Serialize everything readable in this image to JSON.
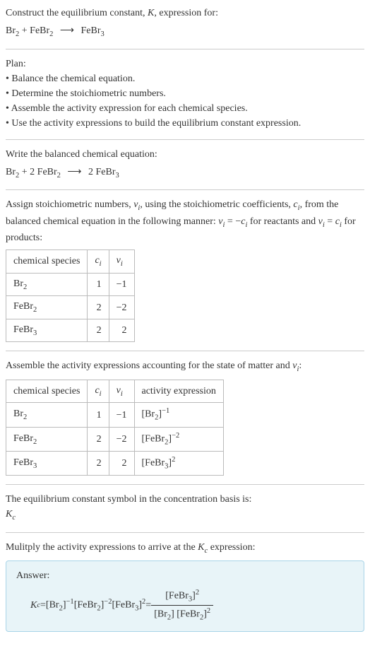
{
  "intro": {
    "line1": "Construct the equilibrium constant, ",
    "K": "K",
    "line1b": ", expression for:",
    "eq_lhs1": "Br",
    "eq_lhs1_sub": "2",
    "plus": " + ",
    "eq_lhs2": "FeBr",
    "eq_lhs2_sub": "2",
    "arrow": "⟶",
    "eq_rhs": "FeBr",
    "eq_rhs_sub": "3"
  },
  "plan": {
    "title": "Plan:",
    "items": [
      "Balance the chemical equation.",
      "Determine the stoichiometric numbers.",
      "Assemble the activity expression for each chemical species.",
      "Use the activity expressions to build the equilibrium constant expression."
    ]
  },
  "balanced": {
    "title": "Write the balanced chemical equation:",
    "c1": "Br",
    "c1_sub": "2",
    "plus": " + ",
    "coef2": "2 ",
    "c2": "FeBr",
    "c2_sub": "2",
    "arrow": "⟶",
    "coef3": "2 ",
    "c3": "FeBr",
    "c3_sub": "3"
  },
  "assign": {
    "text1": "Assign stoichiometric numbers, ",
    "nu": "ν",
    "sub_i": "i",
    "text2": ", using the stoichiometric coefficients, ",
    "c": "c",
    "text3": ", from the balanced chemical equation in the following manner: ",
    "rel1a": "ν",
    "rel1b": " = −",
    "rel1c": "c",
    "text4": " for reactants and ",
    "rel2a": "ν",
    "rel2b": " = ",
    "rel2c": "c",
    "text5": " for products:"
  },
  "table1": {
    "h1": "chemical species",
    "h2": "c",
    "h2_sub": "i",
    "h3": "ν",
    "h3_sub": "i",
    "rows": [
      {
        "sp": "Br",
        "sp_sub": "2",
        "c": "1",
        "nu": "−1"
      },
      {
        "sp": "FeBr",
        "sp_sub": "2",
        "c": "2",
        "nu": "−2"
      },
      {
        "sp": "FeBr",
        "sp_sub": "3",
        "c": "2",
        "nu": "2"
      }
    ]
  },
  "assemble": {
    "text": "Assemble the activity expressions accounting for the state of matter and ",
    "nu": "ν",
    "sub_i": "i",
    "colon": ":"
  },
  "table2": {
    "h1": "chemical species",
    "h2": "c",
    "h2_sub": "i",
    "h3": "ν",
    "h3_sub": "i",
    "h4": "activity expression",
    "rows": [
      {
        "sp": "Br",
        "sp_sub": "2",
        "c": "1",
        "nu": "−1",
        "ae_sp": "Br",
        "ae_sub": "2",
        "ae_exp": "−1"
      },
      {
        "sp": "FeBr",
        "sp_sub": "2",
        "c": "2",
        "nu": "−2",
        "ae_sp": "FeBr",
        "ae_sub": "2",
        "ae_exp": "−2"
      },
      {
        "sp": "FeBr",
        "sp_sub": "3",
        "c": "2",
        "nu": "2",
        "ae_sp": "FeBr",
        "ae_sub": "3",
        "ae_exp": "2"
      }
    ]
  },
  "symbol": {
    "text": "The equilibrium constant symbol in the concentration basis is:",
    "K": "K",
    "c": "c"
  },
  "multiply": {
    "text1": "Mulitply the activity expressions to arrive at the ",
    "K": "K",
    "c": "c",
    "text2": " expression:"
  },
  "answer": {
    "label": "Answer:",
    "K": "K",
    "c": "c",
    "eq": " = ",
    "t1": "[Br",
    "t1_sub": "2",
    "t1_exp": "−1",
    "t2": " [FeBr",
    "t2_sub": "2",
    "t2_exp": "−2",
    "t3": " [FeBr",
    "t3_sub": "3",
    "t3_exp": "2",
    "eq2": " = ",
    "num": "[FeBr",
    "num_sub": "3",
    "num_exp": "2",
    "d1": "[Br",
    "d1_sub": "2",
    "d2": " [FeBr",
    "d2_sub": "2",
    "d2_exp": "2",
    "rb": "]"
  }
}
